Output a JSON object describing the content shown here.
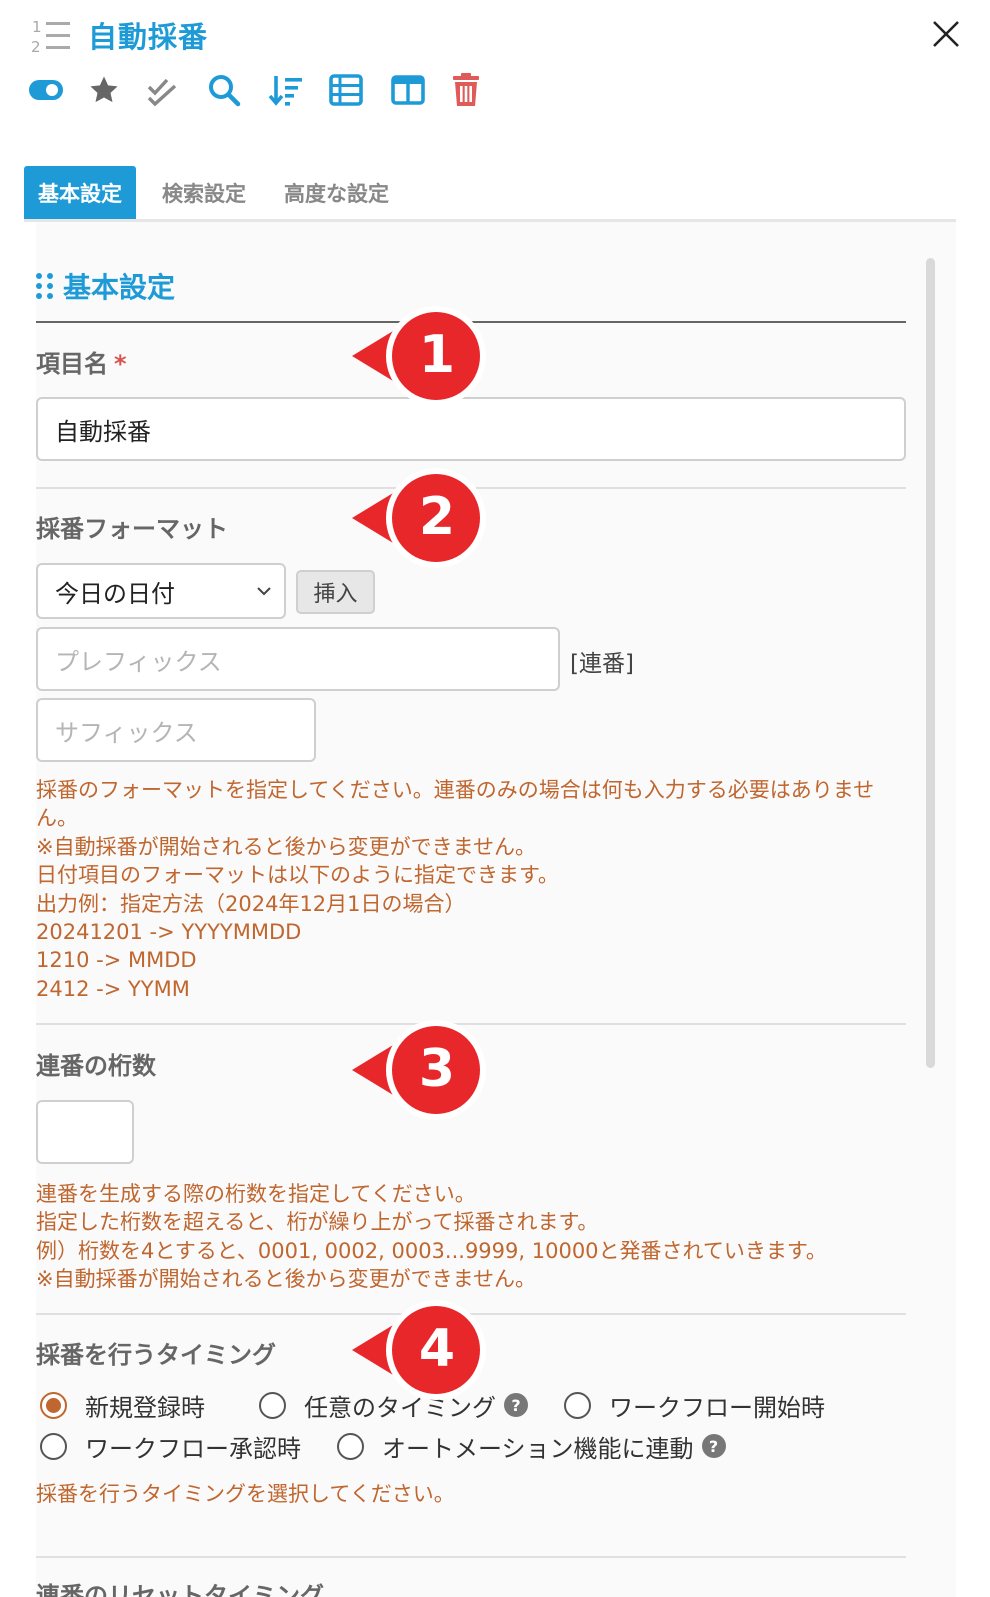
{
  "header": {
    "title": "自動採番",
    "icon": "numbered-list-icon",
    "close_icon": "close-icon"
  },
  "toolbar": {
    "icons": [
      "toggle-icon",
      "star-icon",
      "double-check-icon",
      "search-icon",
      "sort-icon",
      "list-icon",
      "columns-icon",
      "trash-icon"
    ],
    "accent_color": "#1e9bd7",
    "danger_color": "#e05a5a"
  },
  "tabs": [
    {
      "label": "基本設定",
      "active": true
    },
    {
      "label": "検索設定",
      "active": false
    },
    {
      "label": "高度な設定",
      "active": false
    }
  ],
  "section": {
    "title": "基本設定"
  },
  "field_name": {
    "label": "項目名",
    "required_mark": "*",
    "value": "自動採番"
  },
  "format": {
    "label": "採番フォーマット",
    "select_value": "今日の日付",
    "insert_label": "挿入",
    "prefix_placeholder": "プレフィックス",
    "serial_text": "[連番]",
    "suffix_placeholder": "サフィックス",
    "help": [
      "採番のフォーマットを指定してください。連番のみの場合は何も入力する必要はありませ",
      "ん。",
      "※自動採番が開始されると後から変更ができません。",
      "日付項目のフォーマットは以下のように指定できます。",
      "出力例：指定方法（2024年12月1日の場合）",
      "20241201 -> YYYYMMDD",
      "1210 -> MMDD",
      "2412 -> YYMM"
    ]
  },
  "digits": {
    "label": "連番の桁数",
    "value": "",
    "help": [
      "連番を生成する際の桁数を指定してください。",
      "指定した桁数を超えると、桁が繰り上がって採番されます。",
      "例）桁数を4とすると、0001, 0002, 0003...9999, 10000と発番されていきます。",
      "※自動採番が開始されると後から変更ができません。"
    ]
  },
  "timing": {
    "label": "採番を行うタイミング",
    "options": [
      {
        "label": "新規登録時",
        "selected": true
      },
      {
        "label": "任意のタイミング",
        "selected": false,
        "help_icon": true
      },
      {
        "label": "ワークフロー開始時",
        "selected": false
      },
      {
        "label": "ワークフロー承認時",
        "selected": false
      },
      {
        "label": "オートメーション機能に連動",
        "selected": false,
        "help_icon": true
      }
    ],
    "help_icon_text": "?",
    "help": "採番を行うタイミングを選択してください。"
  },
  "reset": {
    "label": "連番のリセットタイミング"
  },
  "callouts": [
    "1",
    "2",
    "3",
    "4"
  ],
  "callout_color": "#e8272b"
}
